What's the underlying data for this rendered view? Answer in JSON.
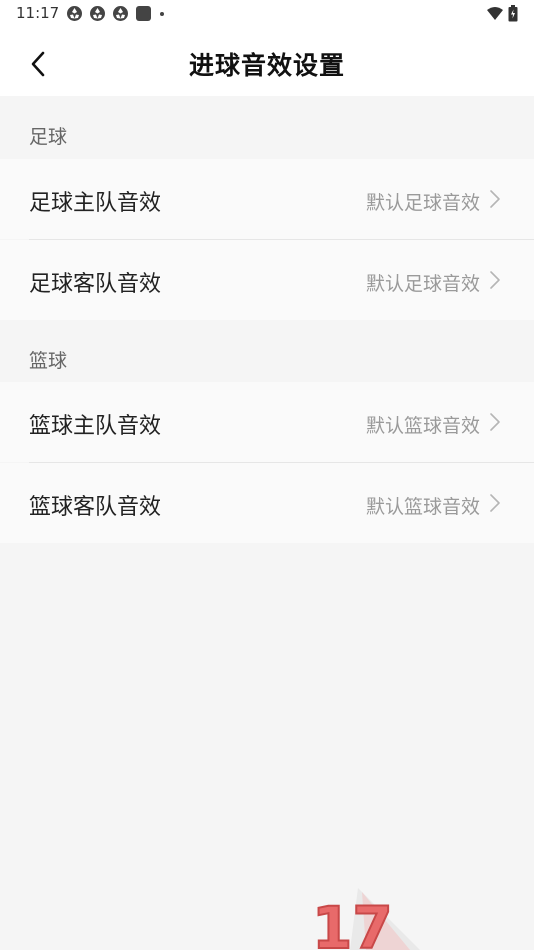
{
  "status_bar": {
    "time": "11:17",
    "left_icons": [
      "app-notification-icon",
      "app-notification-icon",
      "app-notification-icon",
      "square-notification-icon",
      "dot-icon"
    ],
    "right_icons": [
      "wifi-icon",
      "battery-icon"
    ]
  },
  "header": {
    "title": "进球音效设置",
    "back_icon": "chevron-left-icon"
  },
  "sections": [
    {
      "title": "足球",
      "rows": [
        {
          "label": "足球主队音效",
          "value": "默认足球音效"
        },
        {
          "label": "足球客队音效",
          "value": "默认足球音效"
        }
      ]
    },
    {
      "title": "篮球",
      "rows": [
        {
          "label": "篮球主队音效",
          "value": "默认篮球音效"
        },
        {
          "label": "篮球客队音效",
          "value": "默认篮球音效"
        }
      ]
    }
  ],
  "watermark": {
    "text": "17"
  },
  "colors": {
    "background": "#f5f5f5",
    "row_background": "#fafafa",
    "label_text": "#222222",
    "value_text": "#9a9a9a",
    "section_text": "#666666"
  }
}
